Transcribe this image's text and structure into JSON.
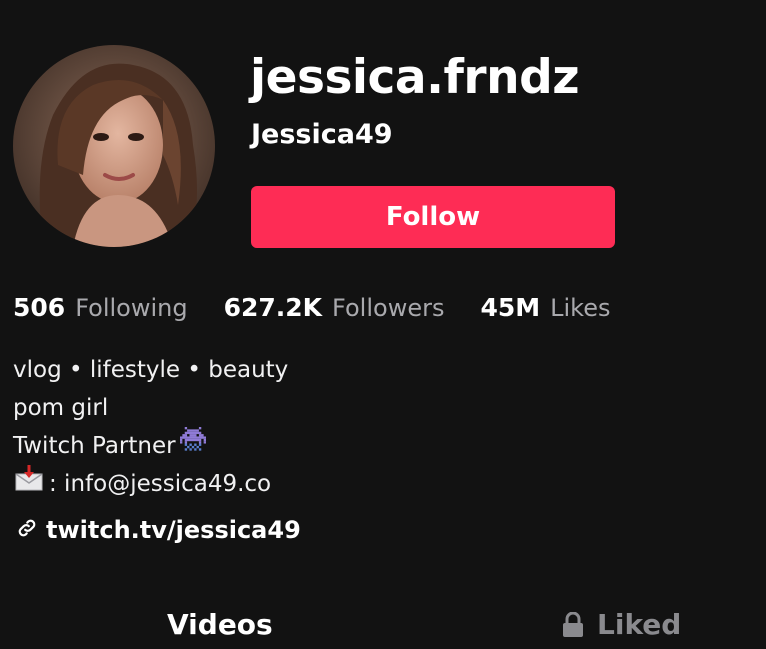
{
  "profile": {
    "username": "jessica.frndz",
    "nickname": "Jessica49",
    "avatar_icon": "profile-photo"
  },
  "actions": {
    "follow_label": "Follow",
    "follow_color": "#fe2c55"
  },
  "stats": [
    {
      "value": "506",
      "label": "Following"
    },
    {
      "value": "627.2K",
      "label": "Followers"
    },
    {
      "value": "45M",
      "label": "Likes"
    }
  ],
  "bio": {
    "line1": "vlog • lifestyle • beauty",
    "line2": "pom girl",
    "line3": "Twitch Partner",
    "line3_icon": "space-invader-icon",
    "line4_icon": "envelope-arrow-icon",
    "line4": ": info@jessica49.co"
  },
  "link": {
    "icon": "link-icon",
    "text": "twitch.tv/jessica49"
  },
  "tabs": [
    {
      "label": "Videos",
      "active": true
    },
    {
      "label": "Liked",
      "icon": "lock-icon",
      "active": false
    }
  ]
}
